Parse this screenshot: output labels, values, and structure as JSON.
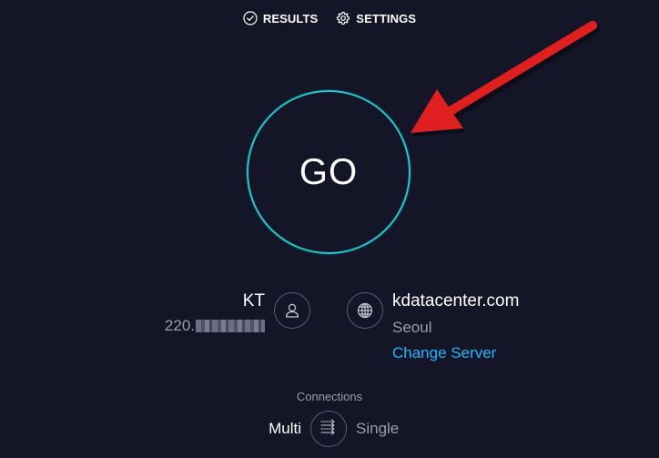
{
  "nav": {
    "results_label": "RESULTS",
    "settings_label": "SETTINGS"
  },
  "go_button": {
    "label": "GO"
  },
  "isp": {
    "name": "KT",
    "ip_prefix": "220."
  },
  "server": {
    "host": "kdatacenter.com",
    "city": "Seoul",
    "change_label": "Change Server"
  },
  "connections": {
    "label": "Connections",
    "multi_label": "Multi",
    "single_label": "Single"
  },
  "colors": {
    "background": "#141526",
    "ring": "#23c8cc",
    "link": "#1fb6ff",
    "muted": "#9b9cae",
    "arrow": "#e0201e"
  },
  "icons": {
    "results": "check-circle-icon",
    "settings": "gear-icon",
    "isp": "user-icon",
    "server": "globe-icon",
    "connections": "connection-arrows-icon"
  }
}
